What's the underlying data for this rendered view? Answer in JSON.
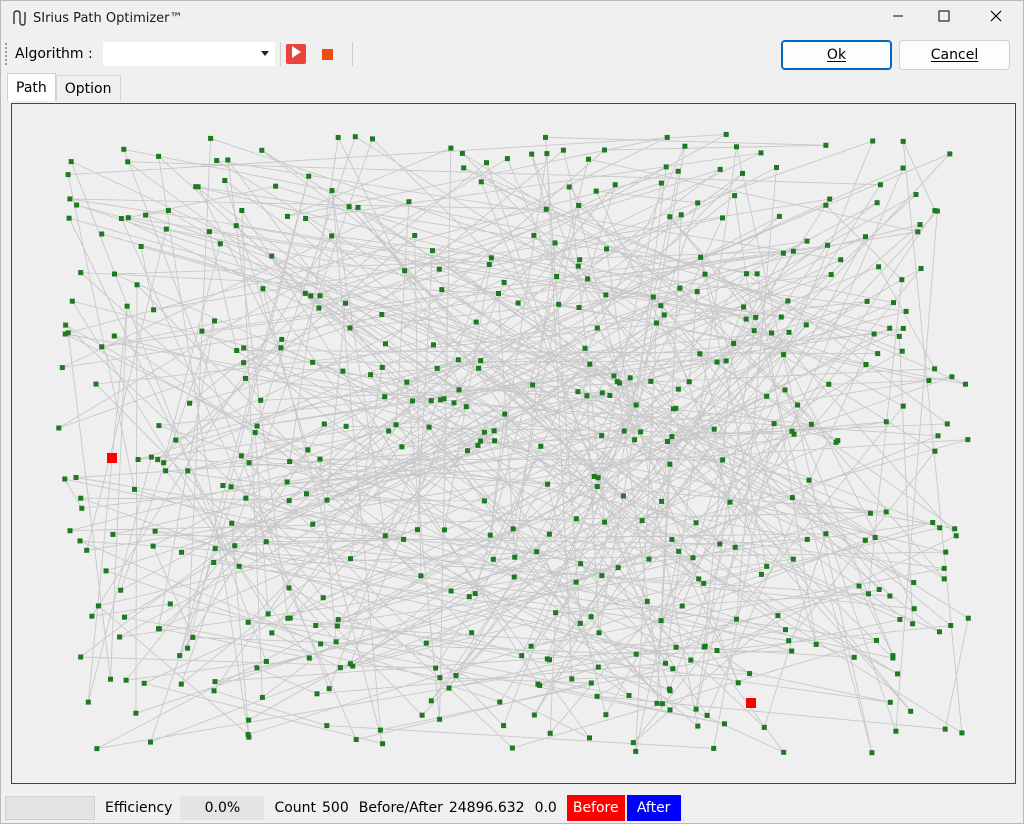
{
  "window": {
    "title": "SIrius Path Optimizer™"
  },
  "toolbar": {
    "algorithm_label": "Algorithm :",
    "algorithm_value": "",
    "play_icon": "play-icon",
    "stop_icon": "stop-icon"
  },
  "buttons": {
    "ok_label": "Ok",
    "cancel_label": "Cancel"
  },
  "tabs": [
    {
      "label": "Path",
      "active": true
    },
    {
      "label": "Option",
      "active": false
    }
  ],
  "canvas": {
    "node_color": "#1e7a1e",
    "edge_color": "#c8c8c8",
    "endpoint_color": "#ff0000"
  },
  "status": {
    "efficiency_label": "Efficiency",
    "efficiency_value": "0.0%",
    "count_label": "Count",
    "count_value": "500",
    "before_after_label": "Before/After",
    "before_value": "24896.632",
    "after_value": "0.0",
    "before_badge": "Before",
    "after_badge": "After",
    "before_color": "#ff0000",
    "after_color": "#0000ff"
  }
}
